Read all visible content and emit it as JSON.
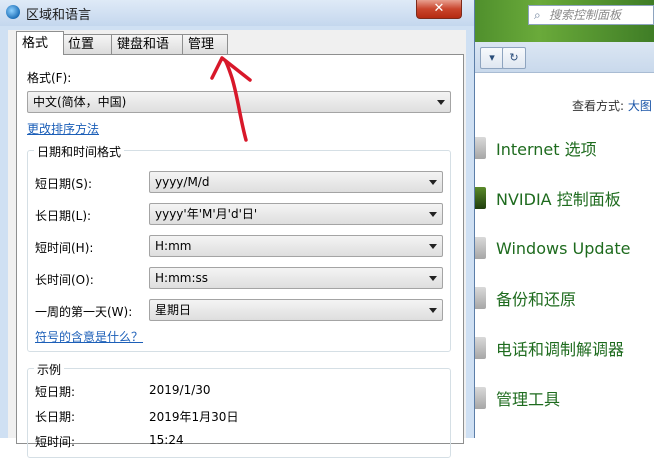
{
  "dialog": {
    "title": "区域和语言",
    "close_glyph": "✕",
    "tabs": [
      {
        "label": "格式"
      },
      {
        "label": "位置"
      },
      {
        "label": "键盘和语言"
      },
      {
        "label": "管理"
      }
    ],
    "format": {
      "label": "格式(F):",
      "value": "中文(简体，中国)",
      "sort_link": "更改排序方法"
    },
    "datetime": {
      "group_title": "日期和时间格式",
      "rows": [
        {
          "label": "短日期(S):",
          "value": "yyyy/M/d"
        },
        {
          "label": "长日期(L):",
          "value": "yyyy'年'M'月'd'日'"
        },
        {
          "label": "短时间(H):",
          "value": "H:mm"
        },
        {
          "label": "长时间(O):",
          "value": "H:mm:ss"
        },
        {
          "label": "一周的第一天(W):",
          "value": "星期日"
        }
      ],
      "symbols_link": "符号的含意是什么？"
    },
    "examples": {
      "group_title": "示例",
      "rows": [
        {
          "label": "短日期:",
          "value": "2019/1/30"
        },
        {
          "label": "长日期:",
          "value": "2019年1月30日"
        },
        {
          "label": "短时间:",
          "value": "15:24"
        }
      ]
    }
  },
  "control_panel": {
    "search_placeholder": "搜索控制面板",
    "view_by_label": "查看方式:",
    "view_by_value": "大图",
    "items": [
      {
        "label": "Internet 选项"
      },
      {
        "label": "NVIDIA 控制面板"
      },
      {
        "label": "Windows Update"
      },
      {
        "label": "备份和还原"
      },
      {
        "label": "电话和调制解调器"
      },
      {
        "label": "管理工具"
      }
    ]
  },
  "colors": {
    "annotation_arrow": "#d8182a",
    "link": "#1c5fb8",
    "cp_text": "#1e6b1e"
  }
}
